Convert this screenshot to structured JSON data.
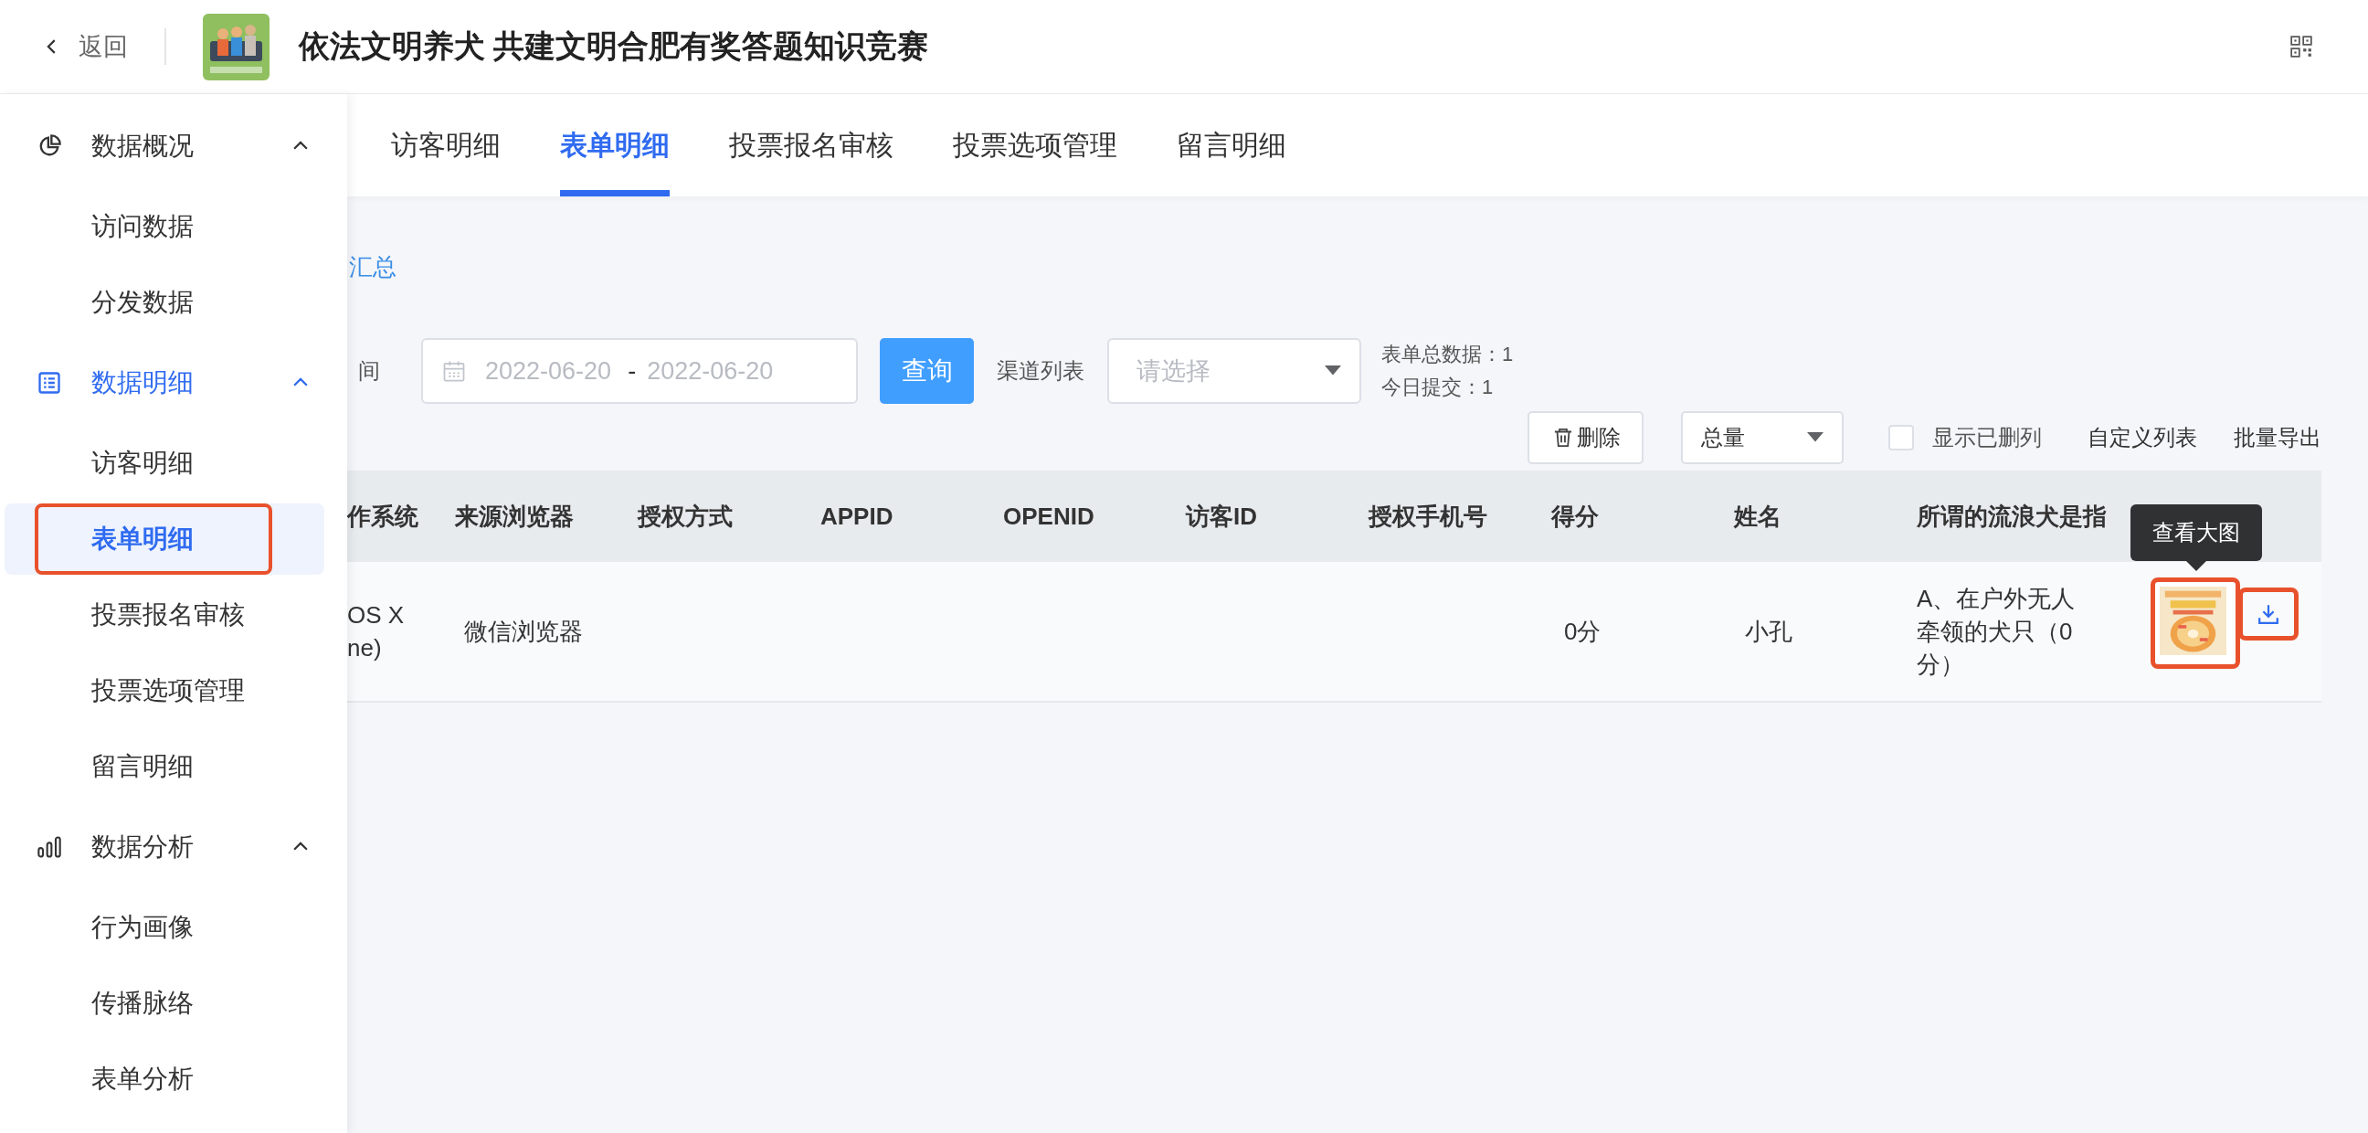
{
  "header": {
    "back": "返回",
    "title": "依法文明养犬 共建文明合肥有奖答题知识竞赛"
  },
  "sidebar": {
    "groups": [
      {
        "label": "数据概况",
        "expanded": true,
        "children": [
          {
            "label": "访问数据",
            "selected": false,
            "highlighted": false
          },
          {
            "label": "分发数据",
            "selected": false,
            "highlighted": false
          }
        ]
      },
      {
        "label": "数据明细",
        "expanded": true,
        "children": [
          {
            "label": "访客明细",
            "selected": false,
            "highlighted": false
          },
          {
            "label": "表单明细",
            "selected": true,
            "highlighted": true
          },
          {
            "label": "投票报名审核",
            "selected": false,
            "highlighted": false
          },
          {
            "label": "投票选项管理",
            "selected": false,
            "highlighted": false
          },
          {
            "label": "留言明细",
            "selected": false,
            "highlighted": false
          }
        ]
      },
      {
        "label": "数据分析",
        "expanded": true,
        "children": [
          {
            "label": "行为画像",
            "selected": false,
            "highlighted": false
          },
          {
            "label": "传播脉络",
            "selected": false,
            "highlighted": false
          },
          {
            "label": "表单分析",
            "selected": false,
            "highlighted": false
          }
        ]
      }
    ]
  },
  "tabs": [
    {
      "label": "访客明细",
      "selected": false
    },
    {
      "label": "表单明细",
      "selected": true
    },
    {
      "label": "投票报名审核",
      "selected": false
    },
    {
      "label": "投票选项管理",
      "selected": false
    },
    {
      "label": "留言明细",
      "selected": false
    }
  ],
  "summary_link": "汇总",
  "filters": {
    "time_label": "间",
    "date_start": "2022-06-20",
    "date_separator": "-",
    "date_end": "2022-06-20",
    "query_button": "查询",
    "channel_label": "渠道列表",
    "channel_select": {
      "placeholder": "请选择"
    },
    "stats": [
      "表单总数据：1",
      "今日提交：1"
    ]
  },
  "toolbar": {
    "delete_button": "删除",
    "total_select": "总量",
    "show_deleted": {
      "label": "显示已删列",
      "checked": false
    },
    "custom_list": "自定义列表",
    "batch_export": "批量导出"
  },
  "table": {
    "columns": [
      {
        "label": "作系统",
        "cells": [
          "OS X\nne)"
        ]
      },
      {
        "label": "来源浏览器",
        "cells": [
          "微信浏览器"
        ]
      },
      {
        "label": "授权方式"
      },
      {
        "label": "APPID"
      },
      {
        "label": "OPENID"
      },
      {
        "label": "访客ID"
      },
      {
        "label": "授权手机号"
      },
      {
        "label": "得分",
        "cells": [
          "0分"
        ]
      },
      {
        "label": "姓名",
        "cells": [
          "小孔"
        ]
      },
      {
        "label": "所谓的流浪犬是指",
        "cells": [
          "A、在户外无人牵领的犬只（0分）"
        ]
      },
      {
        "cells": [
          {
            "kind": "picture",
            "highlighted": true,
            "tooltip": "查看大图",
            "download_highlighted": true
          }
        ]
      }
    ]
  }
}
